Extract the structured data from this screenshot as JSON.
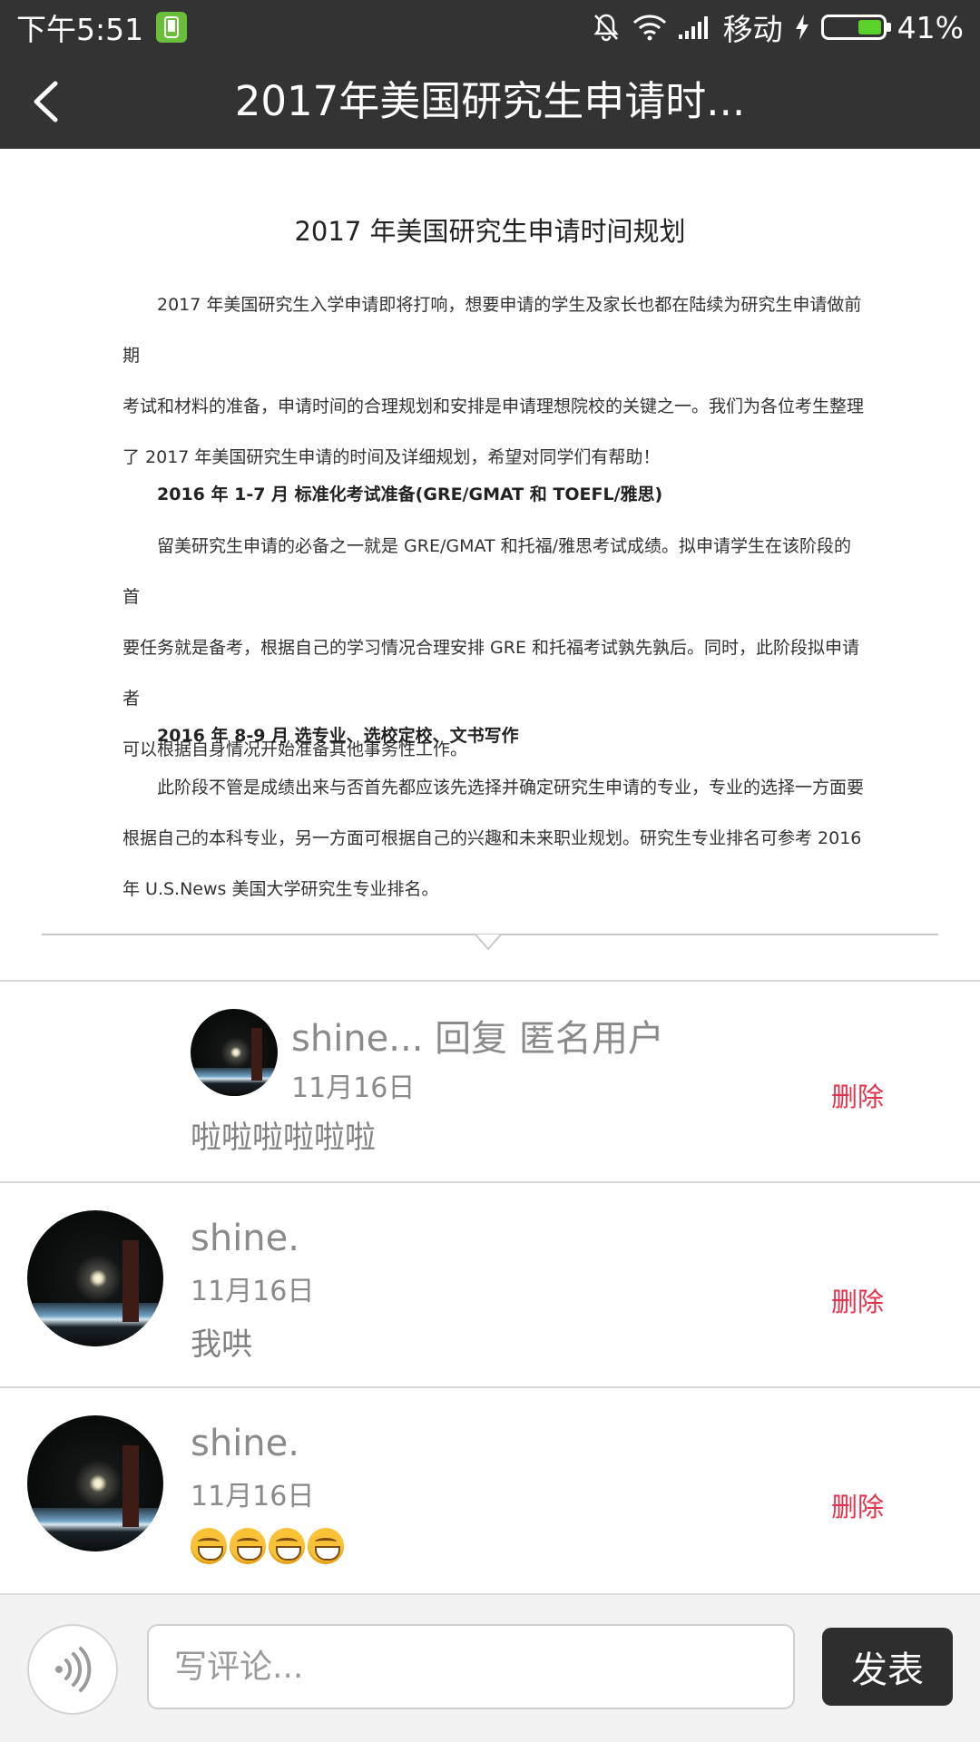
{
  "status_bar": {
    "time": "下午5:51",
    "carrier": "移动",
    "battery_percent": "41%",
    "battery_level": 0.41,
    "icons": [
      "phone-app-icon",
      "mute-icon",
      "wifi-icon",
      "signal-icon",
      "charging-icon",
      "battery-icon"
    ]
  },
  "nav": {
    "title": "2017年美国研究生申请时...",
    "back_icon": "back-arrow-icon"
  },
  "article": {
    "title": "2017 年美国研究生申请时间规划",
    "para1": [
      "2017 年美国研究生入学申请即将打响，想要申请的学生及家长也都在陆续为研究生申请做前期",
      "考试和材料的准备，申请时间的合理规划和安排是申请理想院校的关键之一。我们为各位考生整理",
      "了 2017 年美国研究生申请的时间及详细规划，希望对同学们有帮助！"
    ],
    "heading1": "2016 年 1-7 月  标准化考试准备(GRE/GMAT 和 TOEFL/雅思)",
    "para2": [
      "留美研究生申请的必备之一就是 GRE/GMAT 和托福/雅思考试成绩。拟申请学生在该阶段的首",
      "要任务就是备考，根据自己的学习情况合理安排 GRE 和托福考试孰先孰后。同时，此阶段拟申请者",
      "可以根据自身情况开始准备其他事务性工作。"
    ],
    "heading2": "2016 年 8-9 月  选专业、选校定校、文书写作",
    "para3": [
      "此阶段不管是成绩出来与否首先都应该先选择并确定研究生申请的专业，专业的选择一方面要",
      "根据自己的本科专业，另一方面可根据自己的兴趣和未来职业规划。研究生专业排名可参考 2016",
      "年 U.S.News 美国大学研究生专业排名。"
    ]
  },
  "comments": [
    {
      "name": "shine... 回复  匿名用户",
      "date": "11月16日",
      "body": "啦啦啦啦啦啦",
      "delete_label": "删除"
    },
    {
      "name": "shine.",
      "date": "11月16日",
      "body": "我哄",
      "delete_label": "删除"
    },
    {
      "name": "shine.",
      "date": "11月16日",
      "emoji_count": 4,
      "emoji_icon": "grinning-face-icon",
      "delete_label": "删除"
    }
  ],
  "bottom_bar": {
    "voice_icon": "voice-input-icon",
    "input_placeholder": "写评论...",
    "input_value": "",
    "publish_label": "发表"
  }
}
